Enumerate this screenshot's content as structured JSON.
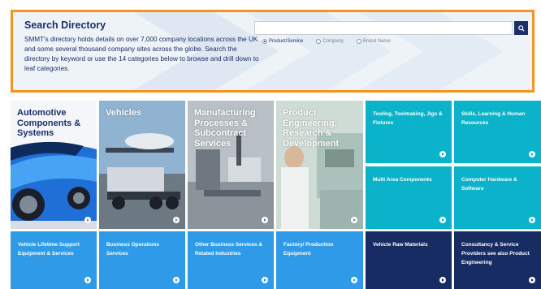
{
  "search": {
    "title": "Search Directory",
    "description": "SMMT's directory holds details on over 7,000 company locations across the UK and some several thousand company sites across the globe. Search the directory by keyword or use the 14 categories below to browse and drill down to leaf categories.",
    "input_value": "",
    "input_placeholder": "",
    "options": [
      "Product/Service",
      "Company",
      "Brand Name"
    ],
    "selected_option": "Product/Service",
    "accent_color": "#f2941f",
    "button_icon": "search-icon"
  },
  "tiles": {
    "automotive": "Automotive Components & Systems",
    "vehicles": "Vehicles",
    "manufacturing": "Manufacturing Processes & Subcontract Services",
    "product_eng": "Product Engineering, Research & Development",
    "tooling": "Tooling, Toolmaking, Jigs & Fixtures",
    "skills": "Skills, Learning & Human Resources",
    "multi_area": "Multi Area Components",
    "computer": "Computer Hardware & Software",
    "lifetime": "Vehicle Lifetime Support Equipment & Services",
    "business_ops": "Business Operations Services",
    "other_business": "Other Business Services & Related Industries",
    "factory": "Factory/ Production Equipment",
    "raw_materials": "Vehicle Raw Materials",
    "consultancy": "Consultancy & Service Providers see also Product Engineering"
  },
  "colors": {
    "teal": "#0ab3c9",
    "blue": "#2f9be8",
    "navy": "#172c63",
    "dark_navy": "#1a2e6c",
    "orange": "#f2941f"
  }
}
